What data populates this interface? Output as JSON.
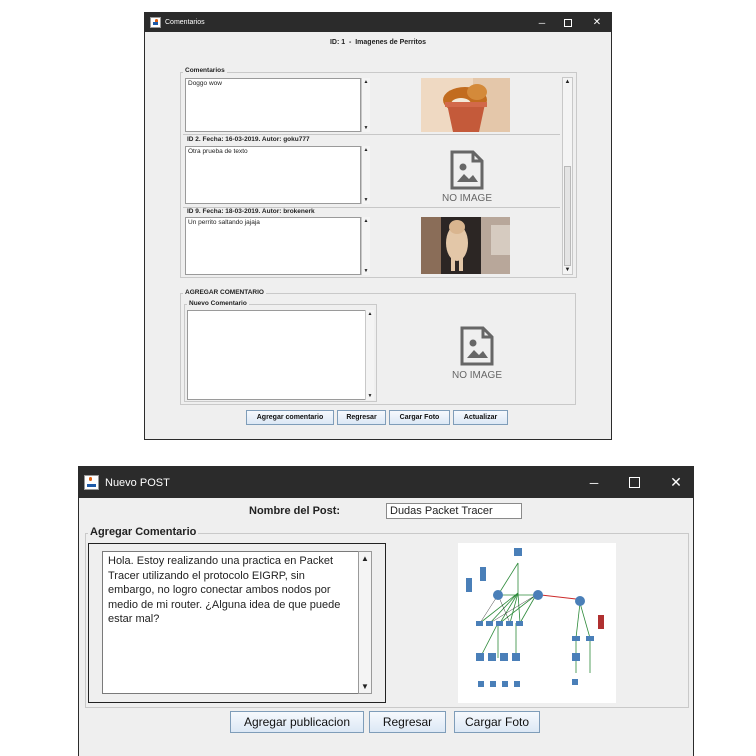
{
  "window1": {
    "title": "Comentarios",
    "header_id": "ID: 1",
    "header_sep": "-",
    "header_title": "Imagenes de Perritos",
    "comments_group_title": "Comentarios",
    "comments": [
      {
        "meta": "",
        "text": "Doggo wow",
        "image": "photo"
      },
      {
        "meta": "ID 2. Fecha: 16-03-2019. Autor: goku777",
        "text": "Otra prueba de texto",
        "image": "none"
      },
      {
        "meta": "ID 9. Fecha: 18-03-2019. Autor: brokenerk",
        "text": "Un perrito saltando jajaja",
        "image": "photo"
      }
    ],
    "no_image_label": "NO IMAGE",
    "add_group_title": "AGREGAR COMENTARIO",
    "new_comment_title": "Nuevo Comentario",
    "new_comment_text": "",
    "buttons": {
      "add": "Agregar comentario",
      "back": "Regresar",
      "upload": "Cargar Foto",
      "refresh": "Actualizar"
    }
  },
  "window2": {
    "title": "Nuevo POST",
    "post_name_label": "Nombre del Post:",
    "post_name_value": "Dudas Packet Tracer",
    "group_title": "Agregar Comentario",
    "comment_text": "Hola. Estoy realizando una practica en Packet Tracer utilizando el protocolo EIGRP, sin embargo, no logro conectar ambos nodos por medio de mi router. ¿Alguna idea de que puede estar mal?",
    "buttons": {
      "publish": "Agregar publicacion",
      "back": "Regresar",
      "upload": "Cargar Foto"
    }
  },
  "colors": {
    "titlebar": "#2b2b2b",
    "window_bg": "#efefef",
    "button_border": "#7f9db9"
  }
}
